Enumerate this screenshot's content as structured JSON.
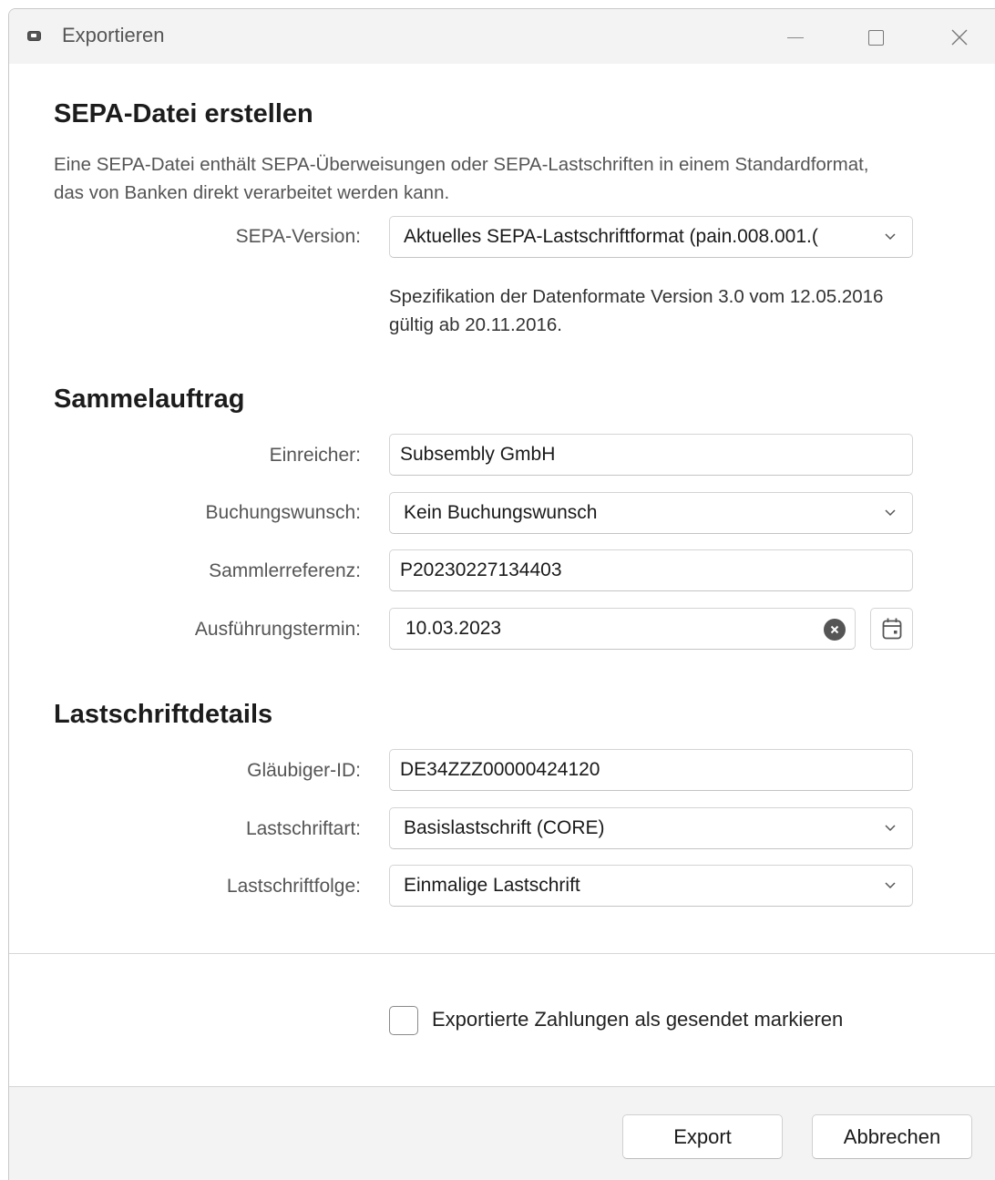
{
  "window": {
    "title": "Exportieren",
    "app_icon": "wallet-icon",
    "controls": [
      "minimize-icon",
      "maximize-icon",
      "close-icon"
    ]
  },
  "sepa_file": {
    "heading": "SEPA-Datei erstellen",
    "description": "Eine SEPA-Datei enthält SEPA-Überweisungen oder SEPA-Lastschriften in einem Standardformat, das von Banken direkt verarbeitet werden kann.",
    "version_label": "SEPA-Version:",
    "version_value": "Aktuelles SEPA-Lastschriftformat (pain.008.001.(",
    "spec_note": "Spezifikation der Datenformate Version 3.0 vom 12.05.2016 gültig ab 20.11.2016."
  },
  "batch": {
    "heading": "Sammelauftrag",
    "submitter_label": "Einreicher:",
    "submitter_value": "Subsembly GmbH",
    "booking_label": "Buchungswunsch:",
    "booking_value": "Kein Buchungswunsch",
    "reference_label": "Sammlerreferenz:",
    "reference_value": "P20230227134403",
    "date_label": "Ausführungstermin:",
    "date_value": "10.03.2023"
  },
  "debit": {
    "heading": "Lastschriftdetails",
    "creditor_label": "Gläubiger-ID:",
    "creditor_value": "DE34ZZZ00000424120",
    "type_label": "Lastschriftart:",
    "type_value": "Basislastschrift (CORE)",
    "sequence_label": "Lastschriftfolge:",
    "sequence_value": "Einmalige Lastschrift"
  },
  "options": {
    "mark_sent_label": "Exportierte Zahlungen als gesendet markieren",
    "mark_sent_checked": false
  },
  "footer": {
    "export_label": "Export",
    "cancel_label": "Abbrechen"
  }
}
